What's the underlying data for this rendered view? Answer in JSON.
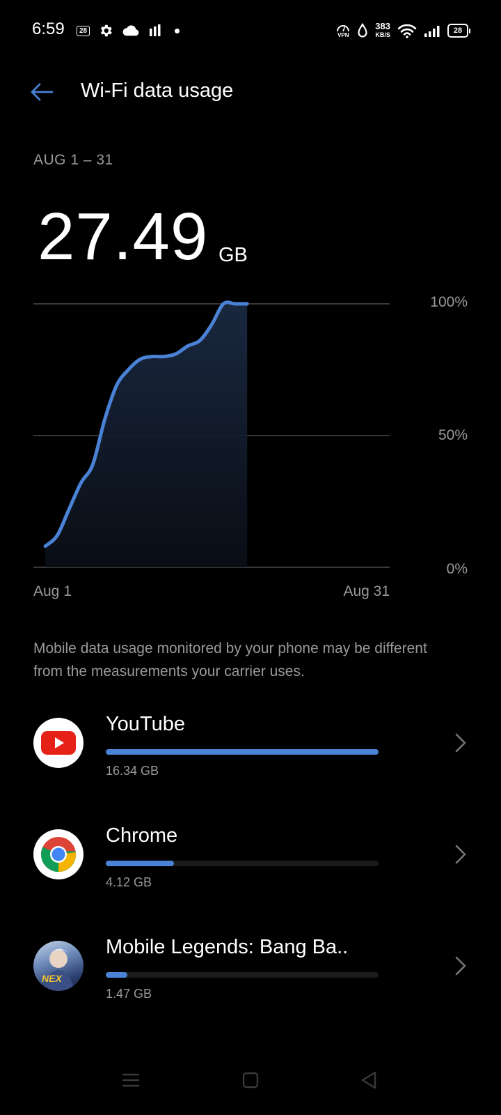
{
  "status_bar": {
    "time": "6:59",
    "notification_badge": "28",
    "vpn_label": "VPN",
    "speed_value": "383",
    "speed_unit": "KB/S",
    "battery": "28",
    "icons": [
      "notification-badge-icon",
      "gear-icon",
      "cloud-icon",
      "signal-bars-icon",
      "dot-icon",
      "vpn-icon",
      "drop-icon",
      "wifi-icon",
      "cell-signal-icon",
      "battery-icon"
    ]
  },
  "header": {
    "title": "Wi-Fi data usage",
    "back_icon": "back-arrow-icon"
  },
  "summary": {
    "period": "AUG 1 – 31",
    "total_value": "27.49",
    "total_unit": "GB"
  },
  "chart_data": {
    "type": "area",
    "x_labels": [
      "Aug 1",
      "Aug 31"
    ],
    "y_ticks": [
      "100%",
      "50%",
      "0%"
    ],
    "ylim": [
      0,
      100
    ],
    "xlim": [
      1,
      31
    ],
    "x": [
      2,
      3,
      4,
      5,
      6,
      7,
      8,
      9,
      10,
      11,
      12,
      13,
      14,
      15,
      16,
      17,
      18,
      19,
      20,
      21,
      22
    ],
    "values": [
      8,
      12,
      22,
      32,
      39,
      56,
      69,
      75,
      79,
      80,
      80,
      81,
      84,
      86,
      92,
      100,
      100,
      100,
      100,
      100,
      100
    ],
    "series_end_day": 19,
    "grid": true,
    "color": "#4a82d6"
  },
  "disclaimer": "Mobile data usage monitored by your phone may be different from the measurements your carrier uses.",
  "apps": [
    {
      "name": "YouTube",
      "size": "16.34 GB",
      "share": 1.0,
      "icon": "youtube-icon"
    },
    {
      "name": "Chrome",
      "size": "4.12 GB",
      "share": 0.25,
      "icon": "chrome-icon"
    },
    {
      "name": "Mobile Legends: Bang Ba..",
      "size": "1.47 GB",
      "share": 0.08,
      "icon": "mobile-legends-icon",
      "icon_text": "NEX"
    }
  ],
  "nav_bar": {
    "icons": [
      "menu-icon",
      "home-icon",
      "back-icon"
    ]
  },
  "colors": {
    "accent": "#4a82d6",
    "background": "#000000",
    "secondary_text": "#9a9a9a"
  }
}
